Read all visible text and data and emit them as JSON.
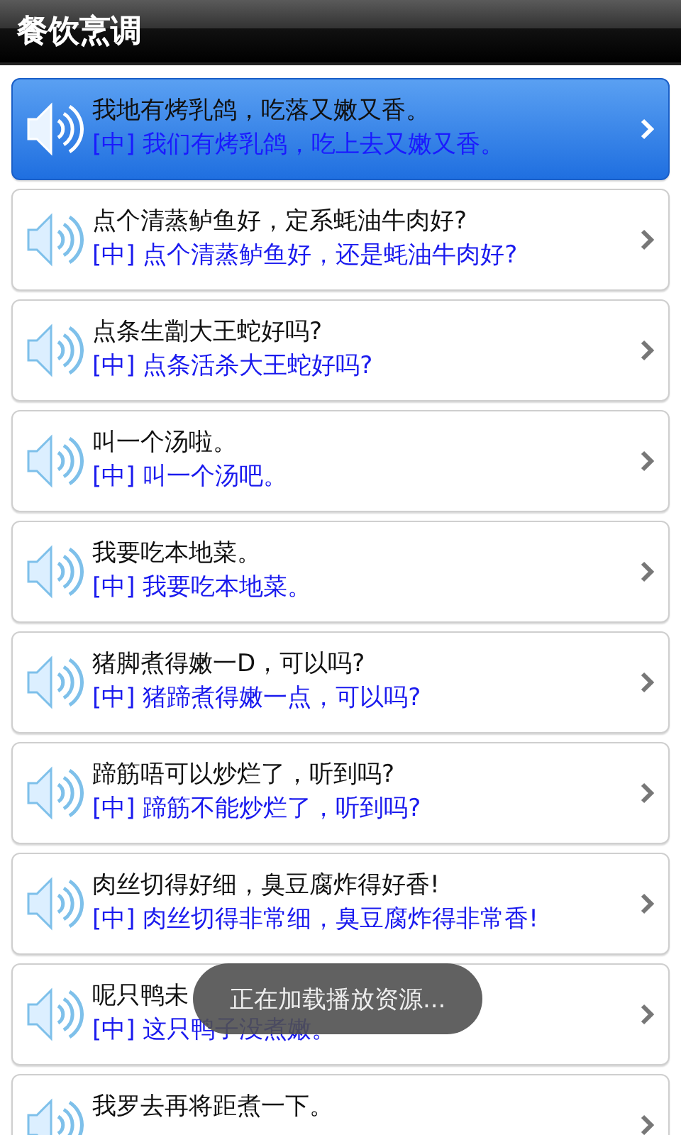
{
  "title_bar": {
    "title": "餐饮烹调"
  },
  "phrases": [
    {
      "cantonese": "我地有烤乳鸽，吃落又嫩又香。",
      "mandarin": "[中] 我们有烤乳鸽，吃上去又嫩又香。",
      "selected": true
    },
    {
      "cantonese": "点个清蒸鲈鱼好，定系蚝油牛肉好?",
      "mandarin": "[中] 点个清蒸鲈鱼好，还是蚝油牛肉好?",
      "selected": false
    },
    {
      "cantonese": "点条生劏大王蛇好吗?",
      "mandarin": "[中] 点条活杀大王蛇好吗?",
      "selected": false
    },
    {
      "cantonese": "叫一个汤啦。",
      "mandarin": "[中] 叫一个汤吧。",
      "selected": false
    },
    {
      "cantonese": "我要吃本地菜。",
      "mandarin": "[中] 我要吃本地菜。",
      "selected": false
    },
    {
      "cantonese": "猪脚煮得嫩一D，可以吗?",
      "mandarin": "[中] 猪蹄煮得嫩一点，可以吗?",
      "selected": false
    },
    {
      "cantonese": "蹄筋唔可以炒烂了，听到吗?",
      "mandarin": "[中] 蹄筋不能炒烂了，听到吗?",
      "selected": false
    },
    {
      "cantonese": "肉丝切得好细，臭豆腐炸得好香!",
      "mandarin": "[中] 肉丝切得非常细，臭豆腐炸得非常香!",
      "selected": false
    },
    {
      "cantonese": "呢只鸭未",
      "mandarin": "[中] 这只鸭子没煮嫩。",
      "selected": false
    },
    {
      "cantonese": "我罗去再将距煮一下。",
      "selected": false
    }
  ],
  "toast": {
    "message": "正在加载播放资源..."
  }
}
